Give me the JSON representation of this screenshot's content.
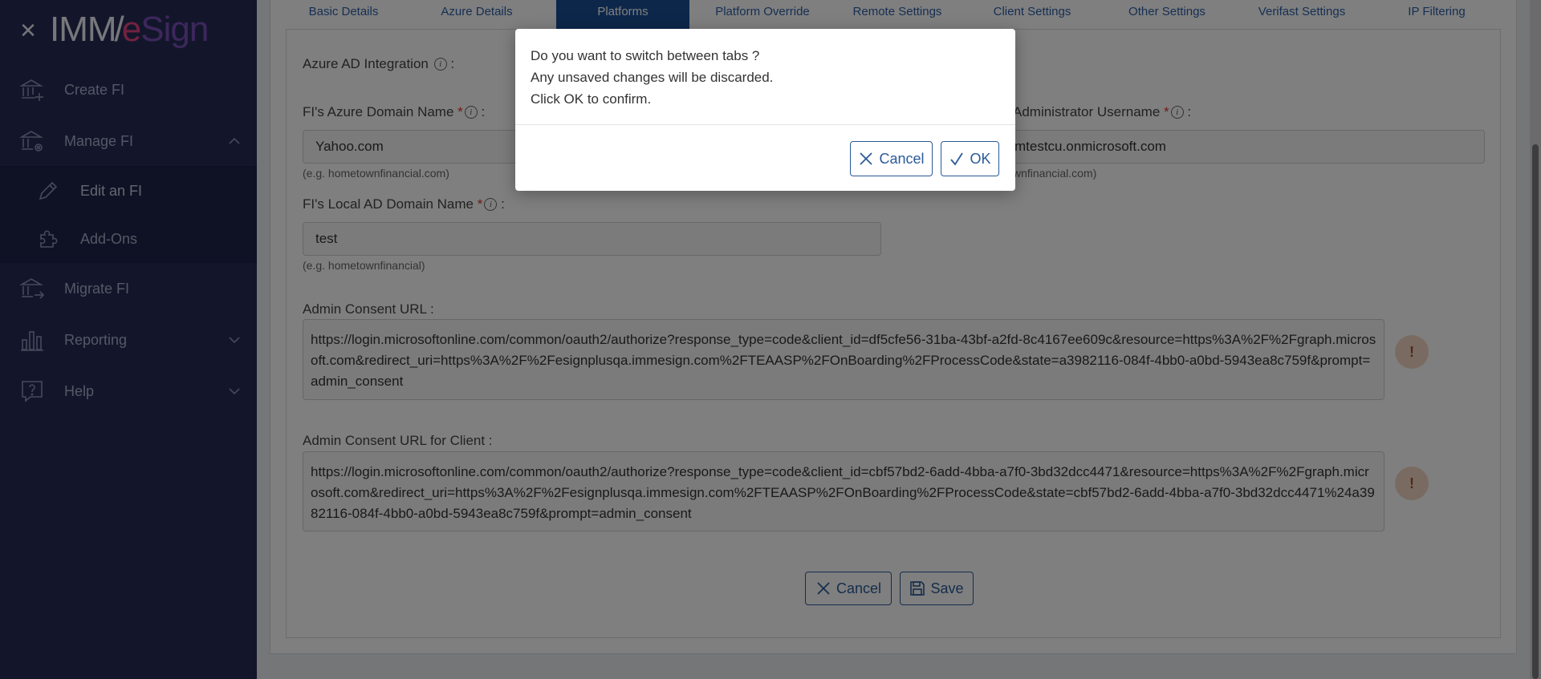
{
  "sidebar": {
    "logo": {
      "imm": "IMM",
      "slash": "/",
      "e": "e",
      "sign": "Sign"
    },
    "items": [
      {
        "label": "Create FI",
        "icon": "bank-plus-icon"
      },
      {
        "label": "Manage FI",
        "icon": "bank-gear-icon",
        "expanded": true
      },
      {
        "label": "Migrate FI",
        "icon": "bank-arrow-icon"
      },
      {
        "label": "Reporting",
        "icon": "bar-chart-icon"
      },
      {
        "label": "Help",
        "icon": "question-bubble-icon"
      }
    ],
    "subitems": [
      {
        "label": "Edit an FI",
        "icon": "pencil-icon"
      },
      {
        "label": "Add-Ons",
        "icon": "puzzle-icon"
      }
    ]
  },
  "tabs": [
    "Basic Details",
    "Azure Details",
    "Platforms",
    "Platform Override",
    "Remote Settings",
    "Client Settings",
    "Other Settings",
    "Verifast Settings",
    "IP Filtering"
  ],
  "active_tab": "Platforms",
  "form": {
    "azure_ad_label": "Azure AD Integration",
    "azure_domain": {
      "label": "FI's Azure Domain Name",
      "value": "Yahoo.com",
      "hint": "(e.g. hometownfinancial.com)"
    },
    "admin_username": {
      "label": "Administrator Username",
      "value": "mtestcu.onmicrosoft.com",
      "hint": "wnfinancial.com)"
    },
    "local_domain": {
      "label": "FI's Local AD Domain Name",
      "value": "test",
      "hint": "(e.g. hometownfinancial)"
    },
    "admin_consent": {
      "label": "Admin Consent URL :",
      "value": "https://login.microsoftonline.com/common/oauth2/authorize?response_type=code&client_id=df5cfe56-31ba-43bf-a2fd-8c4167ee609c&resource=https%3A%2F%2Fgraph.microsoft.com&redirect_uri=https%3A%2F%2Fesignplusqa.immesign.com%2FTEAASP%2FOnBoarding%2FProcessCode&state=a3982116-084f-4bb0-a0bd-5943ea8c759f&prompt=admin_consent"
    },
    "admin_consent_client": {
      "label": "Admin Consent URL for Client :",
      "value": "https://login.microsoftonline.com/common/oauth2/authorize?response_type=code&client_id=cbf57bd2-6add-4bba-a7f0-3bd32dcc4471&resource=https%3A%2F%2Fgraph.microsoft.com&redirect_uri=https%3A%2F%2Fesignplusqa.immesign.com%2FTEAASP%2FOnBoarding%2FProcessCode&state=cbf57bd2-6add-4bba-a7f0-3bd32dcc4471%24a3982116-084f-4bb0-a0bd-5943ea8c759f&prompt=admin_consent"
    },
    "warn_symbol": "!",
    "required_mark": "*",
    "info_symbol": "i",
    "colon": ":"
  },
  "footer": {
    "cancel_label": "Cancel",
    "save_label": "Save"
  },
  "modal": {
    "line1": "Do you want to switch between tabs ?",
    "line2": "Any unsaved changes will be discarded.",
    "line3": "Click OK to confirm.",
    "cancel_label": "Cancel",
    "ok_label": "OK"
  },
  "colors": {
    "sidebar_bg": "#262d57",
    "sidebar_sub_bg": "#1d2448",
    "tab_active_bg": "#1a4f95",
    "accent": "#2a5a99",
    "logo_e": "#e3457f",
    "logo_sign": "#7a4fb8",
    "required": "#d9352f"
  }
}
